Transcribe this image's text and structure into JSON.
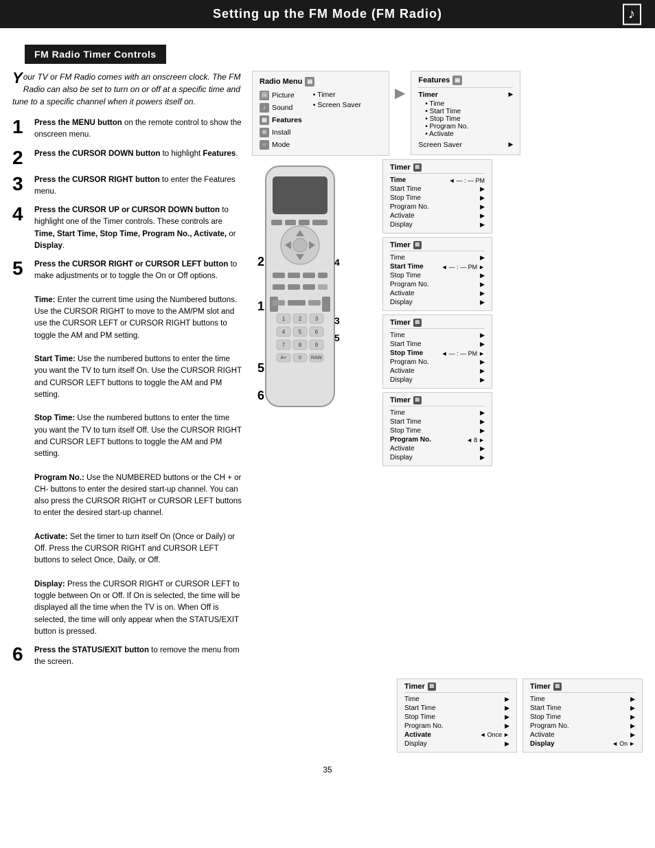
{
  "header": {
    "title": "Setting up the FM Mode (FM Radio)",
    "music_icon": "♪"
  },
  "section_title": "FM Radio Timer Controls",
  "intro": {
    "drop_cap": "Y",
    "text": "our TV or FM Radio comes with an onscreen clock. The FM Radio can also be set to turn on or off at a specific time and tune to a specific channel when it powers itself on."
  },
  "steps": [
    {
      "number": "1",
      "text": "Press the MENU button on the remote control to show the onscreen menu."
    },
    {
      "number": "2",
      "text": "Press the CURSOR DOWN button to highlight Features."
    },
    {
      "number": "3",
      "text": "Press the CURSOR RIGHT button to enter the Features menu."
    },
    {
      "number": "4",
      "text": "Press the CURSOR UP or CURSOR DOWN button to highlight one of the Timer controls. These controls are Time, Start Time, Stop Time, Program No., Activate, or Display."
    },
    {
      "number": "5",
      "text": "Press the CURSOR RIGHT or CURSOR LEFT button to make adjustments or to toggle the On or Off options.\nTime: Enter the current time using the Numbered buttons. Use the CURSOR RIGHT to move to the AM/PM slot and use the CURSOR LEFT or CURSOR RIGHT buttons to toggle the AM and PM setting.\nStart Time: Use the numbered buttons to enter the time you want the TV to turn itself On. Use the CURSOR RIGHT and CURSOR LEFT buttons to toggle the AM and PM setting.\nStop Time: Use the numbered buttons to enter the time you want the TV to turn itself Off. Use the CURSOR RIGHT and CURSOR LEFT buttons to toggle the AM and PM setting.\nProgram No.: Use the NUMBERED buttons or the CH + or CH- buttons to enter the desired start-up channel. You can also press the CURSOR RIGHT or CURSOR LEFT buttons to enter the desired start-up channel.\nActivate: Set the timer to turn itself On (Once or Daily) or Off. Press the CURSOR RIGHT and CURSOR LEFT buttons to select Once, Daily, or Off.\nDisplay: Press the CURSOR RIGHT or CURSOR LEFT to toggle between On or Off. If On is selected, the time will be displayed all the time when the TV is on. When Off is selected, the time will only appear when the STATUS/EXIT button is pressed."
    },
    {
      "number": "6",
      "text": "Press the STATUS/EXIT button to remove the menu from the screen."
    }
  ],
  "radio_menu": {
    "title": "Radio Menu",
    "items_left": [
      "Picture",
      "Sound",
      "Features",
      "Install",
      "Mode"
    ],
    "items_right": [
      "Timer",
      "Screen Saver"
    ]
  },
  "features_panel": {
    "title": "Features",
    "rows": [
      {
        "label": "Timer",
        "sub": [
          "Time",
          "Start Time",
          "Stop Time",
          "Program No.",
          "Activate"
        ]
      },
      {
        "label": "Screen Saver",
        "arrow": "▶"
      }
    ]
  },
  "timer_panels": [
    {
      "id": "time",
      "title": "Timer",
      "rows": [
        {
          "label": "Time",
          "active": true,
          "arrow": "◄",
          "value": "— : — PM",
          "right_arrow": "►"
        },
        {
          "label": "Start Time",
          "arrow": "▶"
        },
        {
          "label": "Stop Time",
          "arrow": "▶"
        },
        {
          "label": "Program No.",
          "arrow": "▶"
        },
        {
          "label": "Activate",
          "arrow": "▶"
        },
        {
          "label": "Display",
          "arrow": "▶"
        }
      ]
    },
    {
      "id": "start_time",
      "title": "Timer",
      "rows": [
        {
          "label": "Time",
          "arrow": "▶"
        },
        {
          "label": "Start Time",
          "active": true,
          "arrow": "◄",
          "value": "— : — PM",
          "right_arrow": "►"
        },
        {
          "label": "Stop Time",
          "arrow": "▶"
        },
        {
          "label": "Program No.",
          "arrow": "▶"
        },
        {
          "label": "Activate",
          "arrow": "▶"
        },
        {
          "label": "Display",
          "arrow": "▶"
        }
      ]
    },
    {
      "id": "stop_time",
      "title": "Timer",
      "rows": [
        {
          "label": "Time",
          "arrow": "▶"
        },
        {
          "label": "Start Time",
          "arrow": "▶"
        },
        {
          "label": "Stop Time",
          "active": true,
          "arrow": "◄",
          "value": "— : — PM",
          "right_arrow": "►"
        },
        {
          "label": "Program No.",
          "arrow": "▶"
        },
        {
          "label": "Activate",
          "arrow": "▶"
        },
        {
          "label": "Display",
          "arrow": "▶"
        }
      ]
    },
    {
      "id": "program_no",
      "title": "Timer",
      "rows": [
        {
          "label": "Time",
          "arrow": "▶"
        },
        {
          "label": "Start Time",
          "arrow": "▶"
        },
        {
          "label": "Stop Time",
          "arrow": "▶"
        },
        {
          "label": "Program No.",
          "active": true,
          "arrow": "◄",
          "value": "8",
          "right_arrow": "►"
        },
        {
          "label": "Activate",
          "arrow": "▶"
        },
        {
          "label": "Display",
          "arrow": "▶"
        }
      ]
    }
  ],
  "bottom_panels": [
    {
      "id": "activate",
      "title": "Timer",
      "rows": [
        {
          "label": "Time",
          "arrow": "▶"
        },
        {
          "label": "Start Time",
          "arrow": "▶"
        },
        {
          "label": "Stop Time",
          "arrow": "▶"
        },
        {
          "label": "Program No.",
          "arrow": "▶"
        },
        {
          "label": "Activate",
          "active": true,
          "arrow": "◄",
          "value": "Once",
          "right_arrow": "►"
        },
        {
          "label": "Display",
          "arrow": "▶"
        }
      ]
    },
    {
      "id": "display",
      "title": "Timer",
      "rows": [
        {
          "label": "Time",
          "arrow": "▶"
        },
        {
          "label": "Start Time",
          "arrow": "▶"
        },
        {
          "label": "Stop Time",
          "arrow": "▶"
        },
        {
          "label": "Program No.",
          "arrow": "▶"
        },
        {
          "label": "Activate",
          "arrow": "▶"
        },
        {
          "label": "Display",
          "active": true,
          "arrow": "◄",
          "value": "On",
          "right_arrow": "►"
        }
      ]
    }
  ],
  "page_number": "35",
  "colors": {
    "header_bg": "#1a1a1a",
    "panel_bg": "#f5f5f5",
    "border": "#cccccc",
    "black": "#000000",
    "white": "#ffffff"
  }
}
